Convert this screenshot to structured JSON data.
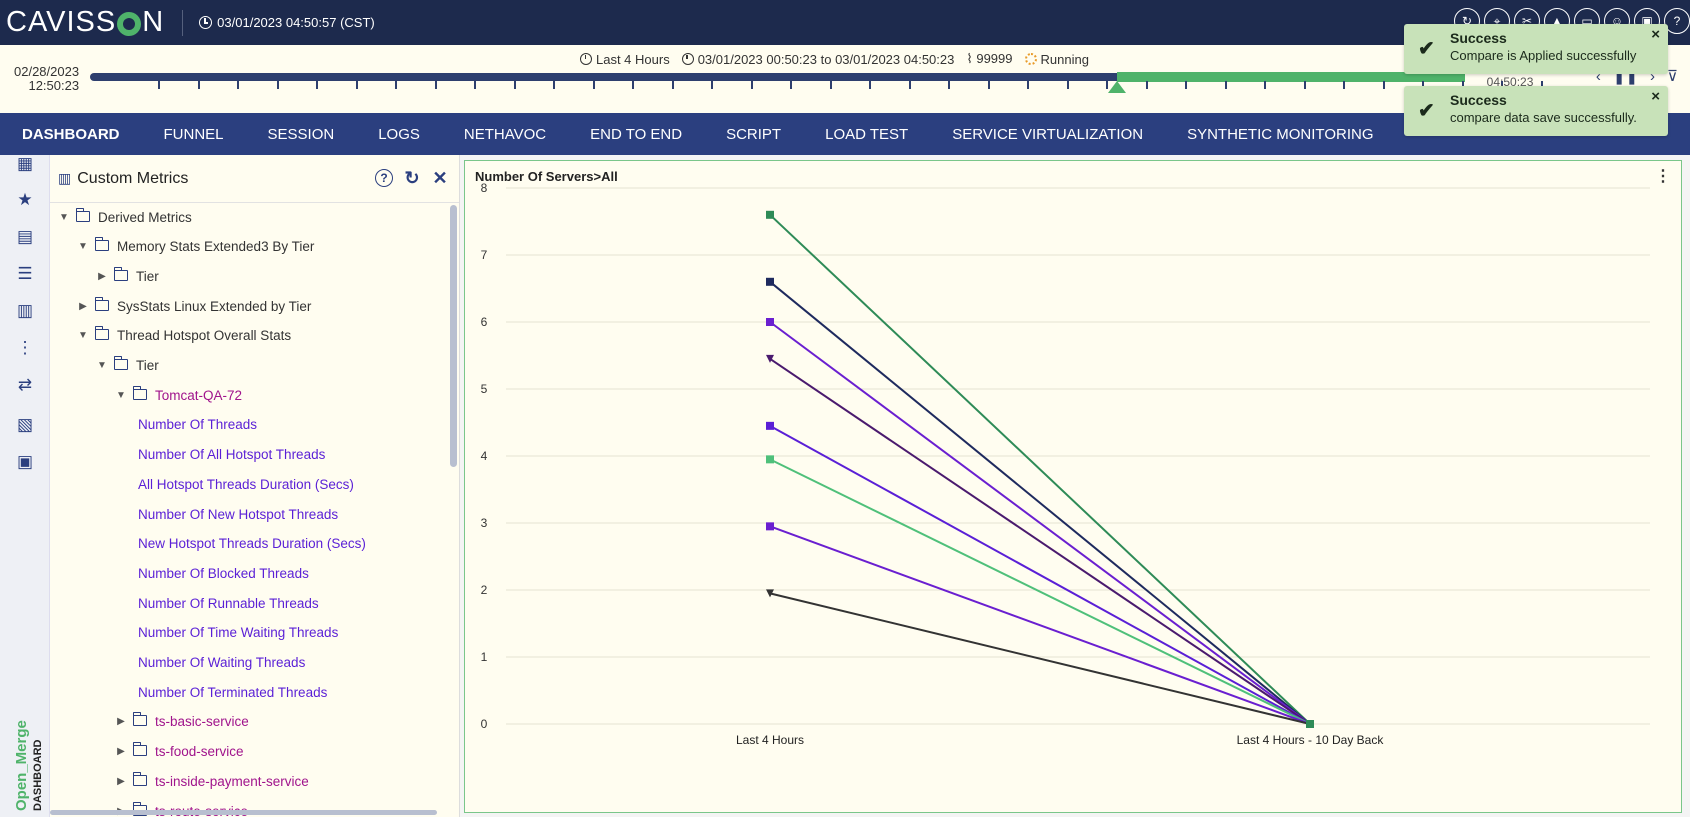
{
  "app": {
    "logo": "CAVISS",
    "logo_end": "N"
  },
  "header": {
    "clock": "03/01/2023 04:50:57 (CST)",
    "icons": [
      "refresh-icon",
      "route-icon",
      "tools-icon",
      "alert-icon",
      "monitor-icon",
      "user-icon",
      "screen-icon",
      "help-icon"
    ]
  },
  "timeline": {
    "left_date": "02/28/2023",
    "left_time": "12:50:23",
    "preset": "Last 4 Hours",
    "from": "03/01/2023 00:50:23",
    "to_word": "to",
    "to": "03/01/2023 04:50:23",
    "count": "99999",
    "status": "Running",
    "right_date": "03/01/2023",
    "right_time": "04:50:23"
  },
  "nav": {
    "items": [
      "DASHBOARD",
      "FUNNEL",
      "SESSION",
      "LOGS",
      "NETHAVOC",
      "END TO END",
      "SCRIPT",
      "LOAD TEST",
      "SERVICE VIRTUALIZATION",
      "SYNTHETIC MONITORING"
    ],
    "active": "DASHBOARD"
  },
  "rail": {
    "label_top": "Open_Merge",
    "label_bottom": "DASHBOARD"
  },
  "tree": {
    "title": "Custom Metrics",
    "items": [
      {
        "label": "Derived Metrics",
        "level": 0,
        "caret": "down",
        "folder": true,
        "color": "dark"
      },
      {
        "label": "Memory Stats Extended3 By Tier",
        "level": 1,
        "caret": "down",
        "folder": true,
        "color": "dark"
      },
      {
        "label": "Tier",
        "level": 2,
        "caret": "right",
        "folder": true,
        "color": "dark"
      },
      {
        "label": "SysStats Linux Extended by Tier",
        "level": 1,
        "caret": "right",
        "folder": true,
        "color": "dark"
      },
      {
        "label": "Thread Hotspot Overall Stats",
        "level": 1,
        "caret": "down",
        "folder": true,
        "color": "dark"
      },
      {
        "label": "Tier",
        "level": 2,
        "caret": "down",
        "folder": true,
        "color": "dark"
      },
      {
        "label": "Tomcat-QA-72",
        "level": 3,
        "caret": "down",
        "folder": true,
        "color": "magenta"
      },
      {
        "label": "Number Of Threads",
        "level": 4,
        "caret": "",
        "folder": false,
        "color": "purple"
      },
      {
        "label": "Number Of All Hotspot Threads",
        "level": 4,
        "caret": "",
        "folder": false,
        "color": "purple"
      },
      {
        "label": "All Hotspot Threads Duration (Secs)",
        "level": 4,
        "caret": "",
        "folder": false,
        "color": "purple"
      },
      {
        "label": "Number Of New Hotspot Threads",
        "level": 4,
        "caret": "",
        "folder": false,
        "color": "purple"
      },
      {
        "label": "New Hotspot Threads Duration (Secs)",
        "level": 4,
        "caret": "",
        "folder": false,
        "color": "purple"
      },
      {
        "label": "Number Of Blocked Threads",
        "level": 4,
        "caret": "",
        "folder": false,
        "color": "purple"
      },
      {
        "label": "Number Of Runnable Threads",
        "level": 4,
        "caret": "",
        "folder": false,
        "color": "purple"
      },
      {
        "label": "Number Of Time Waiting Threads",
        "level": 4,
        "caret": "",
        "folder": false,
        "color": "purple"
      },
      {
        "label": "Number Of Waiting Threads",
        "level": 4,
        "caret": "",
        "folder": false,
        "color": "purple"
      },
      {
        "label": "Number Of Terminated Threads",
        "level": 4,
        "caret": "",
        "folder": false,
        "color": "purple"
      },
      {
        "label": "ts-basic-service",
        "level": 3,
        "caret": "right",
        "folder": true,
        "color": "magenta"
      },
      {
        "label": "ts-food-service",
        "level": 3,
        "caret": "right",
        "folder": true,
        "color": "magenta"
      },
      {
        "label": "ts-inside-payment-service",
        "level": 3,
        "caret": "right",
        "folder": true,
        "color": "magenta"
      },
      {
        "label": "ts-route-service",
        "level": 3,
        "caret": "right",
        "folder": true,
        "color": "magenta"
      }
    ]
  },
  "chart_panel": {
    "title": "Number Of Servers>All"
  },
  "chart_data": {
    "type": "line",
    "title": "Number Of Servers>All",
    "categories": [
      "Last 4 Hours",
      "Last 4 Hours - 10 Day Back"
    ],
    "ylim": [
      0,
      8
    ],
    "yticks": [
      0,
      1,
      2,
      3,
      4,
      5,
      6,
      7,
      8
    ],
    "grid": true,
    "series": [
      {
        "values": [
          7.6,
          0
        ],
        "color": "#2e8b57",
        "marker": "square"
      },
      {
        "values": [
          6.6,
          0
        ],
        "color": "#1e2a5e",
        "marker": "square"
      },
      {
        "values": [
          6.0,
          0
        ],
        "color": "#6a1fd0",
        "marker": "square"
      },
      {
        "values": [
          5.45,
          0
        ],
        "color": "#4a1a6e",
        "marker": "triangle"
      },
      {
        "values": [
          4.45,
          0
        ],
        "color": "#5a1fd6",
        "marker": "square"
      },
      {
        "values": [
          3.95,
          0
        ],
        "color": "#4fc07a",
        "marker": "square"
      },
      {
        "values": [
          2.95,
          0
        ],
        "color": "#6a1fd0",
        "marker": "square"
      },
      {
        "values": [
          1.95,
          0
        ],
        "color": "#333333",
        "marker": "triangle"
      }
    ]
  },
  "toasts": [
    {
      "title": "Success",
      "message": "Compare is Applied successfully",
      "close": "×",
      "check": "✔"
    },
    {
      "title": "Success",
      "message": "compare data save successfully.",
      "close": "×",
      "check": "✔"
    }
  ]
}
